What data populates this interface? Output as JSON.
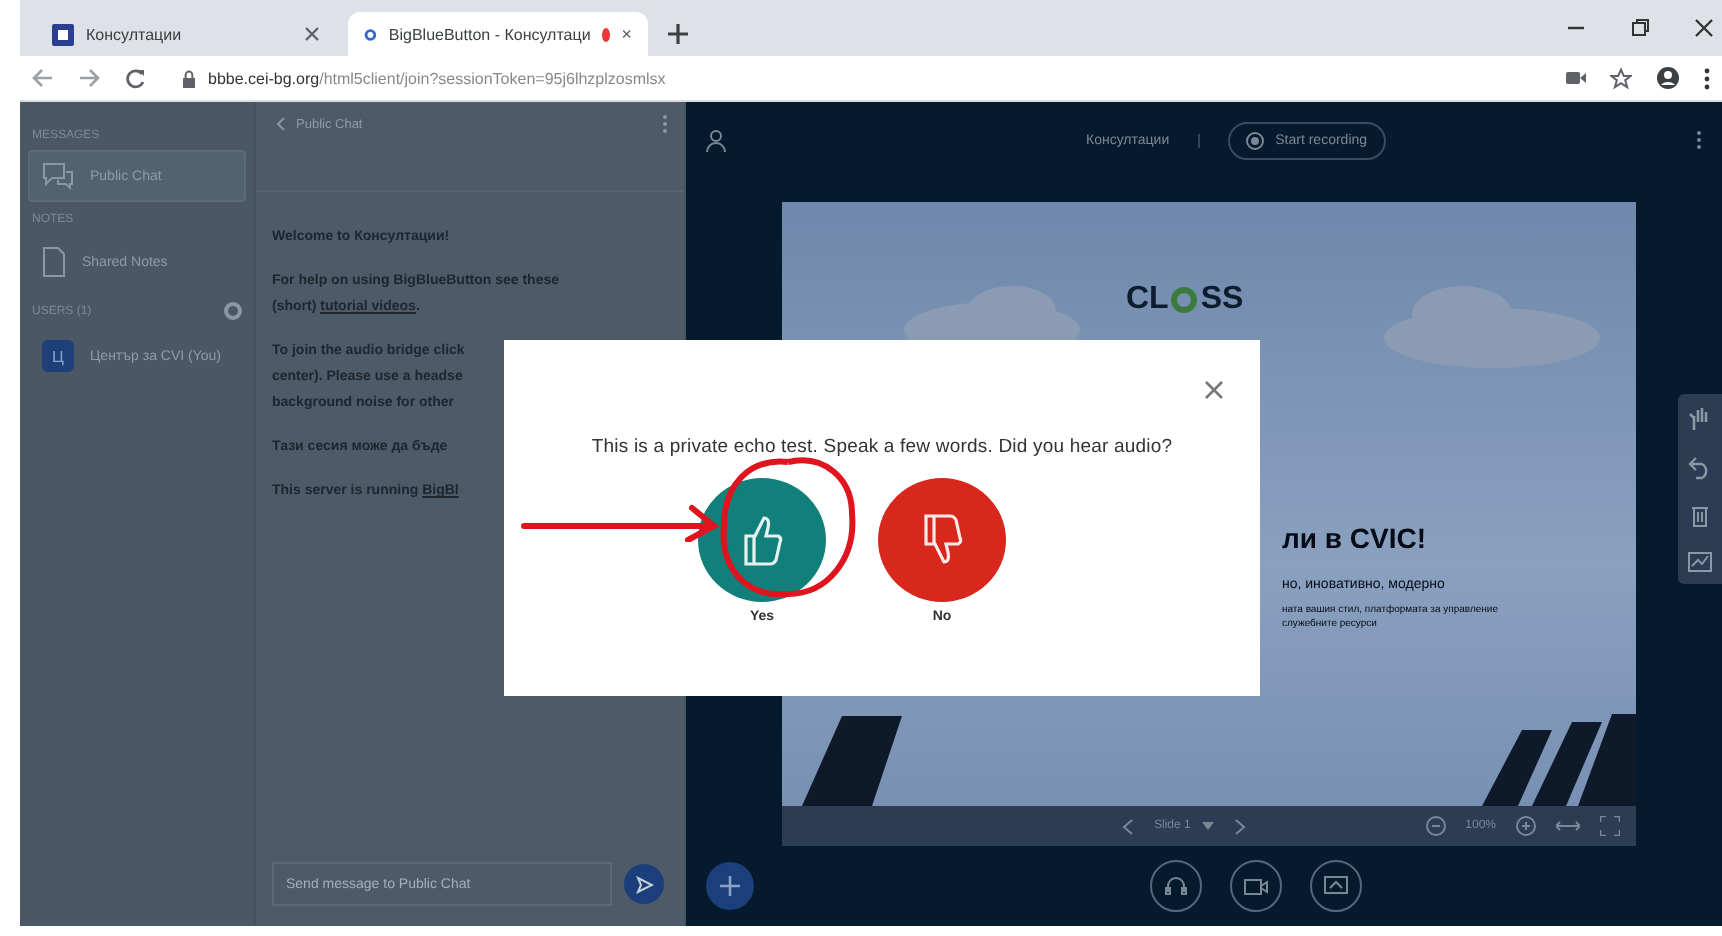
{
  "browser": {
    "tabs": [
      {
        "title": "Консултации",
        "selected": false,
        "recording": false
      },
      {
        "title": "BigBlueButton - Консултаци",
        "selected": true,
        "recording": true
      }
    ],
    "url_host": "bbbe.cei-bg.org",
    "url_path": "/html5client/join?sessionToken=95j6lhzplzosmlsx"
  },
  "sidebar": {
    "sections": [
      {
        "heading": "MESSAGES",
        "items": [
          {
            "label": "Public Chat",
            "kind": "chat",
            "selected": true
          }
        ]
      },
      {
        "heading": "NOTES",
        "items": [
          {
            "label": "Shared Notes",
            "kind": "notes",
            "selected": false
          }
        ]
      },
      {
        "heading": "USERS (1)",
        "items": [
          {
            "label": "Център за CVI (You)",
            "kind": "user",
            "avatar": "Ц",
            "selected": false
          }
        ]
      }
    ]
  },
  "chat": {
    "title": "Public Chat",
    "messages": [
      {
        "lines": [
          "Welcome to **Консултации**!"
        ]
      },
      {
        "lines": [
          "For help on using BigBlueButton see these",
          "(short) "
        ],
        "link": "tutorial videos",
        "after": "."
      },
      {
        "lines": [
          "To join the audio bridge click",
          "center). Please use a headse",
          "background noise for other"
        ]
      },
      {
        "lines": [
          "Тази сесия може да бъде"
        ]
      },
      {
        "lines": [
          "This server is running "
        ],
        "link": "BigBl"
      }
    ],
    "placeholder": "Send message to Public Chat"
  },
  "main": {
    "title": "Консултации",
    "record_label": "Start recording",
    "slide": {
      "logo_left": "CL",
      "logo_right": "SS",
      "heading": "ли в CVIC!",
      "subtitle": "но, иновативно, модерно",
      "body": [
        "ната вашия стил, платформата за управление",
        "служебните ресурси"
      ]
    },
    "slide_label": "Slide 1",
    "zoom": "100%"
  },
  "modal": {
    "message": "This is a private echo test. Speak a few words. Did you hear audio?",
    "answers": [
      {
        "label": "Yes",
        "kind": "yes"
      },
      {
        "label": "No",
        "kind": "no"
      }
    ]
  }
}
